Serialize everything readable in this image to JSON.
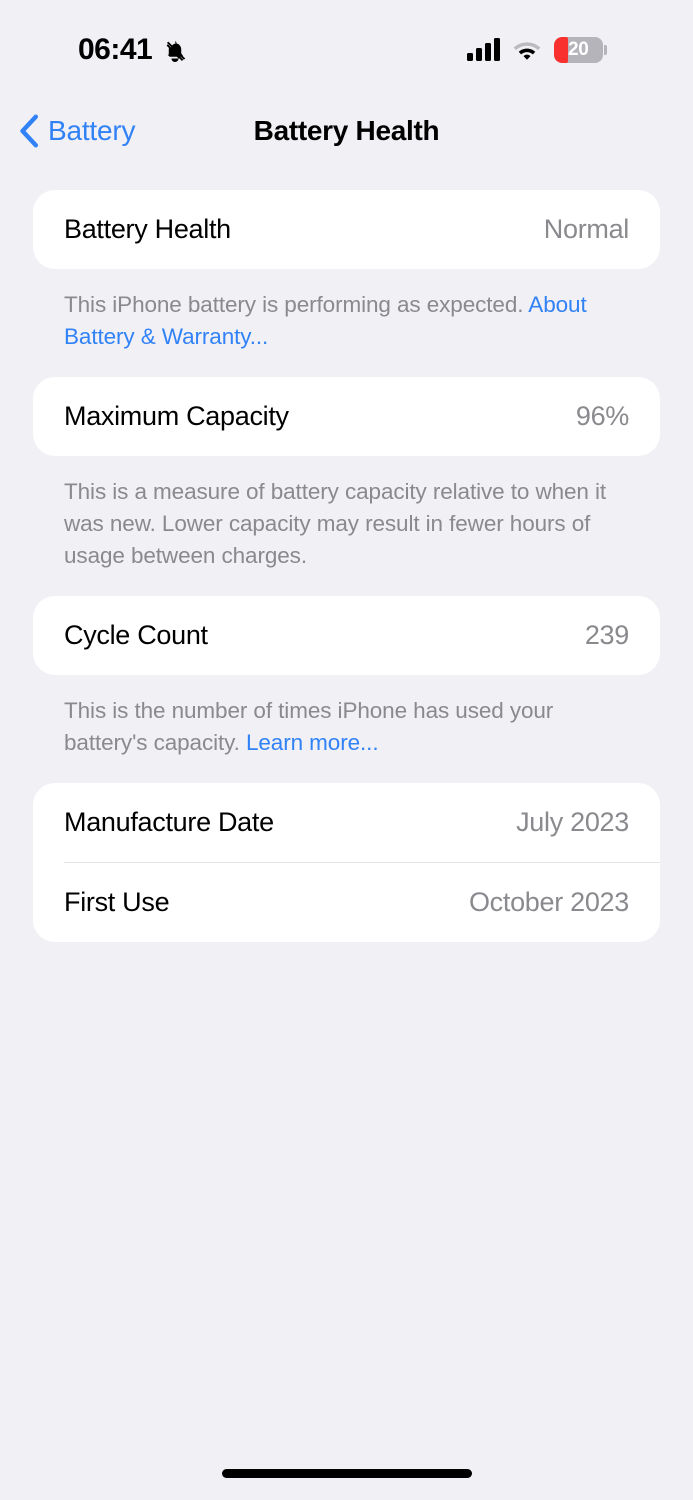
{
  "status_bar": {
    "time": "06:41",
    "silent_icon": "bell-slash-icon",
    "cellular_icon": "signal-bars-icon",
    "cellular_bars": 4,
    "wifi_icon": "wifi-icon",
    "battery_icon": "battery-icon",
    "battery_level": "20",
    "battery_percent": 20,
    "battery_color": "#f8312f"
  },
  "nav": {
    "back_icon": "chevron-left-icon",
    "back_label": "Battery",
    "title": "Battery Health",
    "accent_color": "#3182f6"
  },
  "sections": [
    {
      "rows": [
        {
          "label": "Battery Health",
          "value": "Normal"
        }
      ],
      "footnote": {
        "text": "This iPhone battery is performing as expected. ",
        "link": "About Battery & Warranty..."
      }
    },
    {
      "rows": [
        {
          "label": "Maximum Capacity",
          "value": "96%"
        }
      ],
      "footnote": {
        "text": "This is a measure of battery capacity relative to when it was new. Lower capacity may result in fewer hours of usage between charges.",
        "link": ""
      }
    },
    {
      "rows": [
        {
          "label": "Cycle Count",
          "value": "239"
        }
      ],
      "footnote": {
        "text": "This is the number of times iPhone has used your battery's capacity. ",
        "link": "Learn more..."
      }
    },
    {
      "rows": [
        {
          "label": "Manufacture Date",
          "value": "July 2023"
        },
        {
          "label": "First Use",
          "value": "October 2023"
        }
      ],
      "footnote": null
    }
  ],
  "home_indicator": "home-indicator"
}
